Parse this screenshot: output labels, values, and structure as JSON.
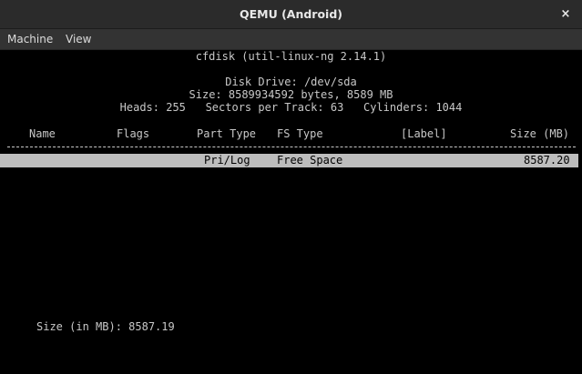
{
  "window": {
    "title": "QEMU (Android)",
    "close_glyph": "×"
  },
  "menubar": {
    "items": [
      "Machine",
      "View"
    ]
  },
  "cfdisk": {
    "header": "cfdisk (util-linux-ng 2.14.1)",
    "disk_drive": "Disk Drive: /dev/sda",
    "size_line": "Size: 8589934592 bytes, 8589 MB",
    "geometry_line": "Heads: 255   Sectors per Track: 63   Cylinders: 1044",
    "columns": {
      "name": "Name",
      "flags": "Flags",
      "part_type": "Part Type",
      "fs_type": "FS Type",
      "label": "[Label]",
      "size": "Size (MB)"
    },
    "separator": "--------------------------------------------------------------------------------",
    "rows": [
      {
        "name": "",
        "flags": "",
        "part_type": "Pri/Log",
        "fs_type": "Free Space",
        "label": "",
        "size": "8587.20",
        "selected": true
      }
    ],
    "prompt": "Size (in MB): 8587.19"
  },
  "colors": {
    "titlebar_bg": "#2b2b2b",
    "menubar_bg": "#333333",
    "terminal_bg": "#000000",
    "terminal_fg": "#c8c8c8",
    "selection_bg": "#bdbdbd"
  }
}
